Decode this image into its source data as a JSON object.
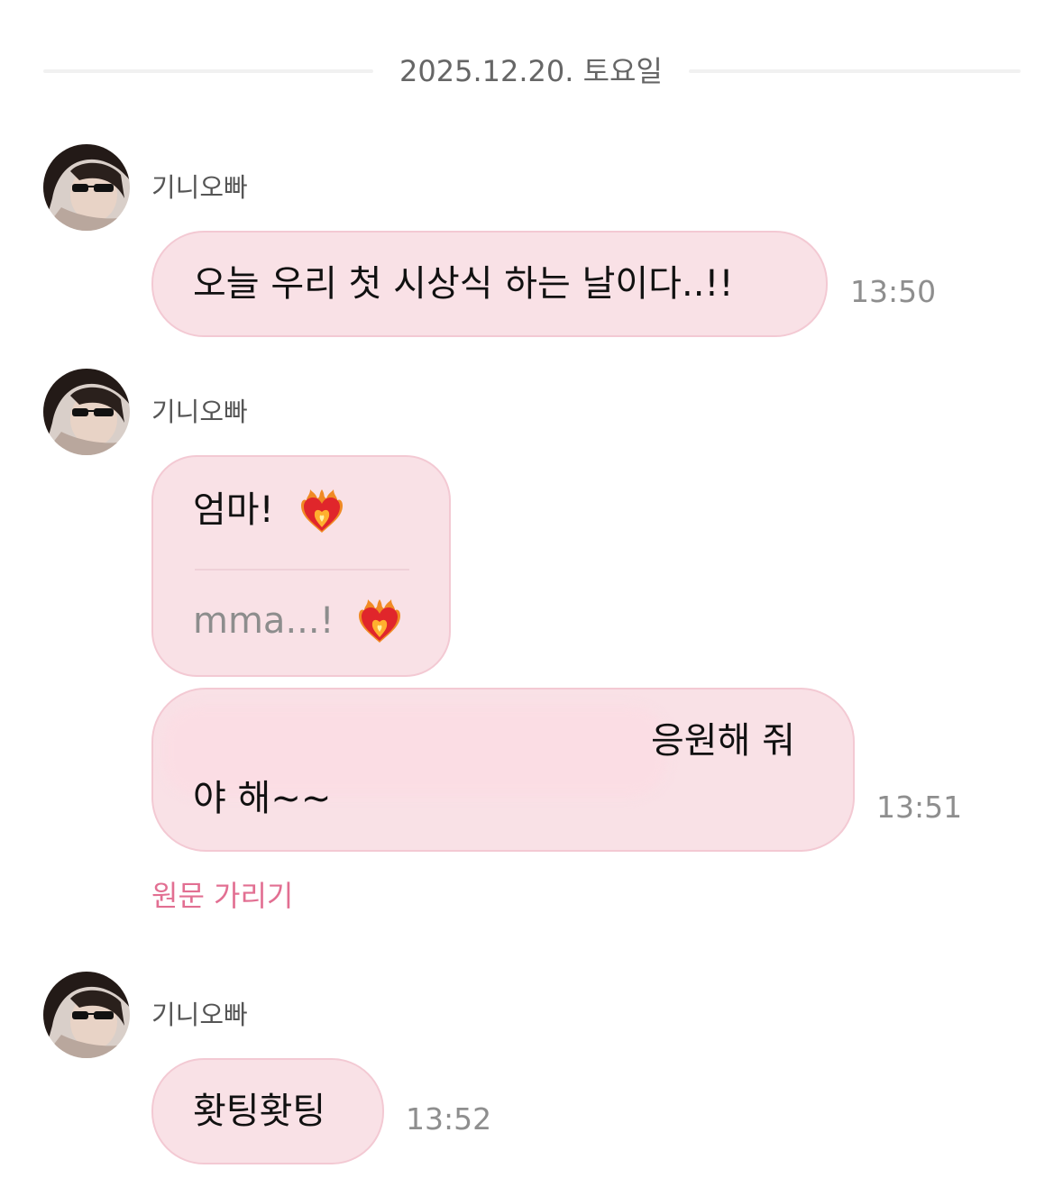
{
  "date_separator": "2025.12.20. 토요일",
  "messages": [
    {
      "sender": "기니오빠",
      "text": "오늘 우리 첫 시상식 하는 날이다..!!",
      "time": "13:50"
    },
    {
      "sender": "기니오빠",
      "original_text": "엄마!",
      "translated_text": "mma...!",
      "emoji": "heart-on-fire-icon"
    },
    {
      "line1": "응원해 줘",
      "line2": "야 해~~",
      "time": "13:51"
    },
    {
      "sender": "기니오빠",
      "text": "홧팅홧팅",
      "time": "13:52"
    }
  ],
  "hide_original_label": "원문 가리기",
  "colors": {
    "bubble_bg": "#f9e1e6",
    "bubble_border": "#f3c9d3",
    "link": "#e26f92"
  }
}
